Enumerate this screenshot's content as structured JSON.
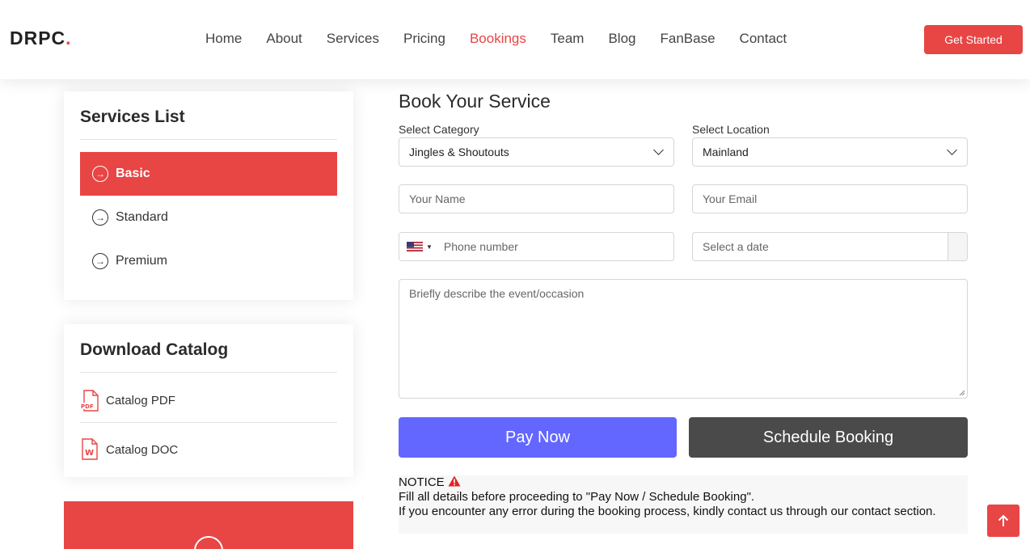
{
  "header": {
    "logo_text": "DRPC",
    "logo_dot": ".",
    "nav": [
      "Home",
      "About",
      "Services",
      "Pricing",
      "Bookings",
      "Team",
      "Blog",
      "FanBase",
      "Contact"
    ],
    "active_nav": "Bookings",
    "cta_label": "Get Started"
  },
  "services": {
    "title": "Services List",
    "items": [
      "Basic",
      "Standard",
      "Premium"
    ],
    "active": "Basic"
  },
  "catalog": {
    "title": "Download Catalog",
    "items": [
      {
        "label": "Catalog PDF",
        "icon": "pdf-file-icon",
        "badge": "PDF"
      },
      {
        "label": "Catalog DOC",
        "icon": "word-file-icon",
        "badge": "W"
      }
    ]
  },
  "form": {
    "title": "Book Your Service",
    "category_label": "Select Category",
    "category_value": "Jingles & Shoutouts",
    "location_label": "Select Location",
    "location_value": "Mainland",
    "name_placeholder": "Your Name",
    "email_placeholder": "Your Email",
    "phone_placeholder": "Phone number",
    "date_placeholder": "Select a date",
    "description_placeholder": "Briefly describe the event/occasion",
    "pay_label": "Pay Now",
    "schedule_label": "Schedule Booking"
  },
  "notice": {
    "heading": "NOTICE",
    "line1": "Fill all details before proceeding to \"Pay Now / Schedule Booking\".",
    "line2": "If you encounter any error during the booking process, kindly contact us through our contact section."
  },
  "colors": {
    "accent": "#e84545",
    "pay_button": "#6366ff",
    "schedule_button": "#4a4a4a"
  },
  "icons": {
    "services_item": "circle-arrow-right-icon",
    "notice": "warning-triangle-icon",
    "scroll_top": "arrow-up-icon",
    "phone_country": "us-flag-icon"
  }
}
